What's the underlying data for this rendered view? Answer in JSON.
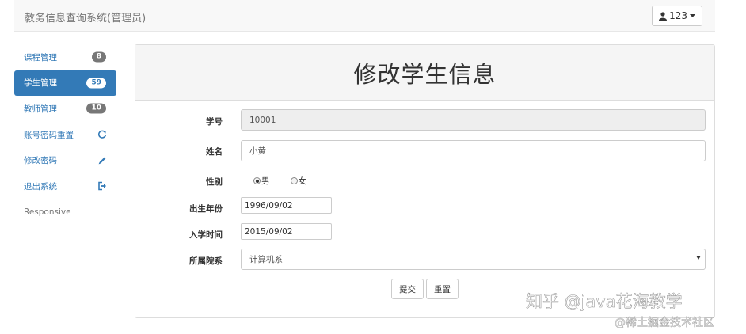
{
  "navbar": {
    "brand": "教务信息查询系统(管理员)",
    "user_label": "123"
  },
  "sidebar": {
    "items": [
      {
        "label": "课程管理",
        "badge": "8"
      },
      {
        "label": "学生管理",
        "badge": "59",
        "active": true
      },
      {
        "label": "教师管理",
        "badge": "10"
      },
      {
        "label": "账号密码重置",
        "icon": "refresh-icon"
      },
      {
        "label": "修改密码",
        "icon": "pencil-icon"
      },
      {
        "label": "退出系统",
        "icon": "logout-icon"
      },
      {
        "label": "Responsive"
      }
    ]
  },
  "form": {
    "title": "修改学生信息",
    "student_id": {
      "label": "学号",
      "value": "10001"
    },
    "name": {
      "label": "姓名",
      "value": "小黄"
    },
    "gender": {
      "label": "性别",
      "options": [
        "男",
        "女"
      ],
      "selected": "男"
    },
    "birth": {
      "label": "出生年份",
      "value": "1996/09/02"
    },
    "enroll": {
      "label": "入学时间",
      "value": "2015/09/02"
    },
    "department": {
      "label": "所属院系",
      "value": "计算机系"
    },
    "submit_label": "提交",
    "reset_label": "重置"
  },
  "watermark": {
    "line1": "知乎 @java花海教学",
    "line2": "@稀土掘金技术社区"
  },
  "colors": {
    "primary": "#337ab7",
    "badge": "#777777",
    "navbar_bg": "#f8f8f8",
    "panel_heading_bg": "#f5f5f5"
  }
}
